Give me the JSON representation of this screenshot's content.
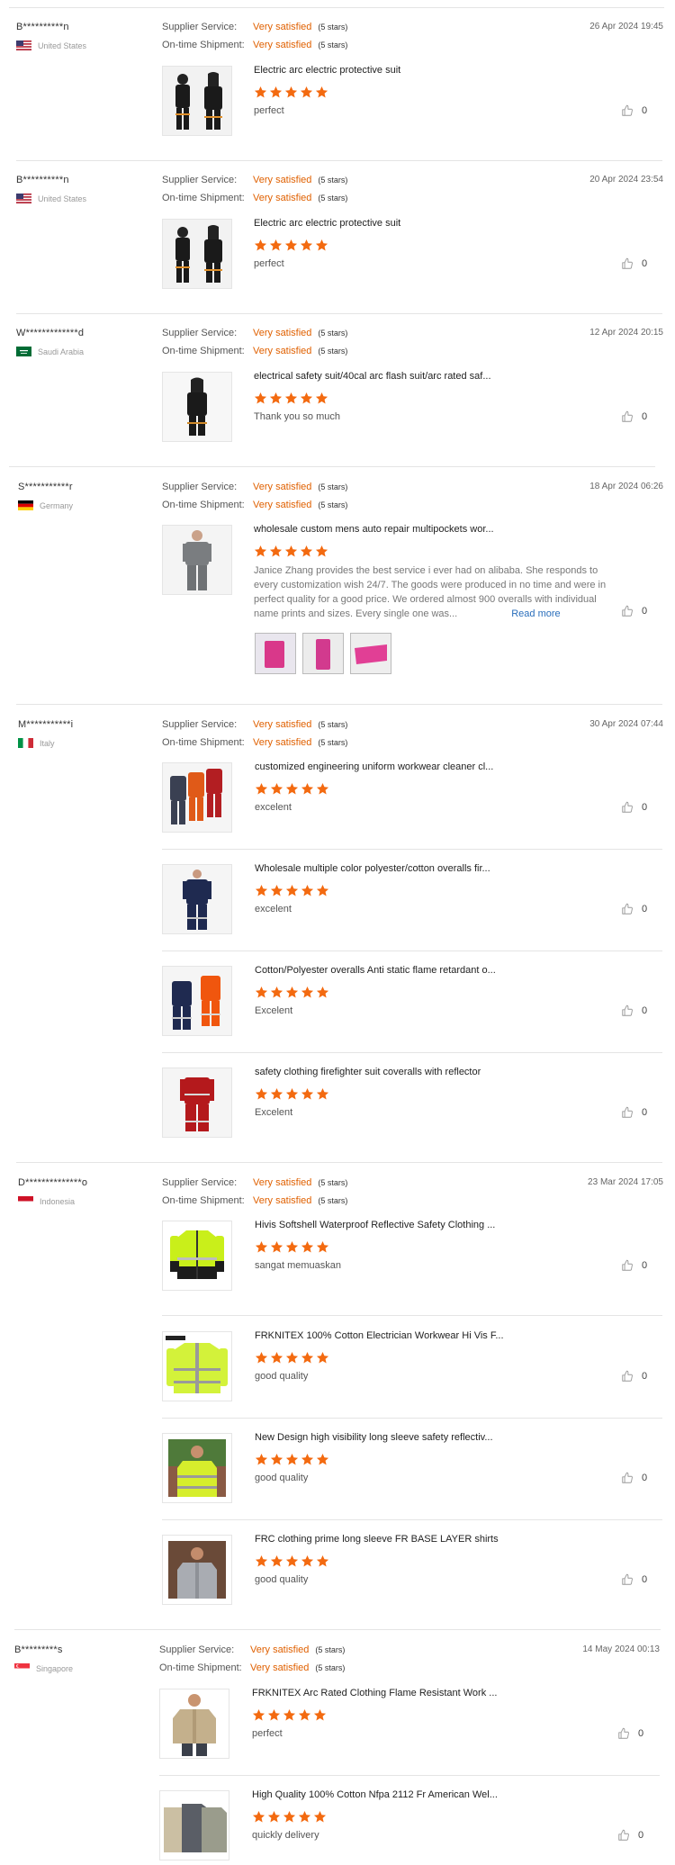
{
  "labels": {
    "supplier_service": "Supplier Service:",
    "ontime_shipment": "On-time Shipment:"
  },
  "colors": {
    "accent": "#e06000",
    "star": "#f36a10",
    "link": "#2a6ebb"
  },
  "reviews": [
    {
      "buyer": "B**********n",
      "country": "United States",
      "flag": "us-flag",
      "date": "26 Apr 2024 19:45",
      "supplier_service": "Very satisfied",
      "supplier_stars": "(5 stars)",
      "ontime_shipment": "Very satisfied",
      "ontime_stars": "(5 stars)",
      "products": [
        {
          "title": "Electric arc electric protective suit",
          "rating": 5,
          "comment": "perfect",
          "likes": "0",
          "thumb": "black-suit"
        }
      ]
    },
    {
      "buyer": "B**********n",
      "country": "United States",
      "flag": "us-flag",
      "date": "20 Apr 2024 23:54",
      "supplier_service": "Very satisfied",
      "supplier_stars": "(5 stars)",
      "ontime_shipment": "Very satisfied",
      "ontime_stars": "(5 stars)",
      "products": [
        {
          "title": "Electric arc electric protective suit",
          "rating": 5,
          "comment": "perfect",
          "likes": "0",
          "thumb": "black-suit"
        }
      ]
    },
    {
      "buyer": "W*************d",
      "country": "Saudi Arabia",
      "flag": "sa-flag",
      "date": "12 Apr 2024 20:15",
      "supplier_service": "Very satisfied",
      "supplier_stars": "(5 stars)",
      "ontime_shipment": "Very satisfied",
      "ontime_stars": "(5 stars)",
      "products": [
        {
          "title": "electrical safety suit/40cal arc flash suit/arc rated saf...",
          "rating": 5,
          "comment": "Thank you so much",
          "likes": "0",
          "thumb": "black-suit-single"
        }
      ]
    },
    {
      "buyer": "S***********r",
      "country": "Germany",
      "flag": "de-flag",
      "date": "18 Apr 2024 06:26",
      "supplier_service": "Very satisfied",
      "supplier_stars": "(5 stars)",
      "ontime_shipment": "Very satisfied",
      "ontime_stars": "(5 stars)",
      "products": [
        {
          "title": "wholesale custom mens auto repair multipockets wor...",
          "rating": 5,
          "comment": "Janice Zhang provides the best service i ever had on alibaba. She responds to every customization wish 24/7. The goods were produced in no time and were in perfect quality for a good price. We ordered almost 900 overalls with individual name prints and sizes. Every single one was...",
          "read_more": "Read more",
          "likes": "0",
          "thumb": "grey-coverall"
        }
      ]
    },
    {
      "buyer": "M***********i",
      "country": "Italy",
      "flag": "it-flag",
      "date": "30 Apr 2024 07:44",
      "supplier_service": "Very satisfied",
      "supplier_stars": "(5 stars)",
      "ontime_shipment": "Very satisfied",
      "ontime_stars": "(5 stars)",
      "products": [
        {
          "title": "customized engineering uniform workwear cleaner cl...",
          "rating": 5,
          "comment": "excelent",
          "likes": "0",
          "thumb": "multi-coverall"
        },
        {
          "title": "Wholesale multiple color polyester/cotton overalls fir...",
          "rating": 5,
          "comment": "excelent",
          "likes": "0",
          "thumb": "navy-coverall"
        },
        {
          "title": "Cotton/Polyester overalls Anti static flame retardant o...",
          "rating": 5,
          "comment": "Excelent",
          "likes": "0",
          "thumb": "navy-orange-coverall"
        },
        {
          "title": "safety clothing firefighter suit coveralls with reflector",
          "rating": 5,
          "comment": "Excelent",
          "likes": "0",
          "thumb": "red-coverall"
        }
      ]
    },
    {
      "buyer": "D**************o",
      "country": "Indonesia",
      "flag": "id-flag",
      "date": "23 Mar 2024 17:05",
      "supplier_service": "Very satisfied",
      "supplier_stars": "(5 stars)",
      "ontime_shipment": "Very satisfied",
      "ontime_stars": "(5 stars)",
      "products": [
        {
          "title": "Hivis Softshell Waterproof Reflective Safety Clothing ...",
          "rating": 5,
          "comment": "sangat memuaskan",
          "likes": "0",
          "thumb": "hivis-jacket"
        },
        {
          "title": "FRKNITEX 100% Cotton Electrician Workwear Hi Vis F...",
          "rating": 5,
          "comment": "good quality",
          "likes": "0",
          "thumb": "hivis-shirt"
        },
        {
          "title": "New Design high visibility long sleeve safety reflectiv...",
          "rating": 5,
          "comment": "good quality",
          "likes": "0",
          "thumb": "hivis-person"
        },
        {
          "title": "FRC clothing prime long sleeve FR BASE LAYER shirts",
          "rating": 5,
          "comment": "good quality",
          "likes": "0",
          "thumb": "grey-shirt-person"
        }
      ]
    },
    {
      "buyer": "B*********s",
      "country": "Singapore",
      "flag": "sg-flag",
      "date": "14 May 2024 00:13",
      "supplier_service": "Very satisfied",
      "supplier_stars": "(5 stars)",
      "ontime_shipment": "Very satisfied",
      "ontime_stars": "(5 stars)",
      "products": [
        {
          "title": "FRKNITEX Arc Rated Clothing Flame Resistant Work ...",
          "rating": 5,
          "comment": "perfect",
          "likes": "0",
          "thumb": "khaki-shirt-person"
        },
        {
          "title": "High Quality 100% Cotton Nfpa 2112 Fr American Wel...",
          "rating": 5,
          "comment": "quickly delivery",
          "likes": "0",
          "thumb": "shirts-group"
        }
      ]
    }
  ]
}
